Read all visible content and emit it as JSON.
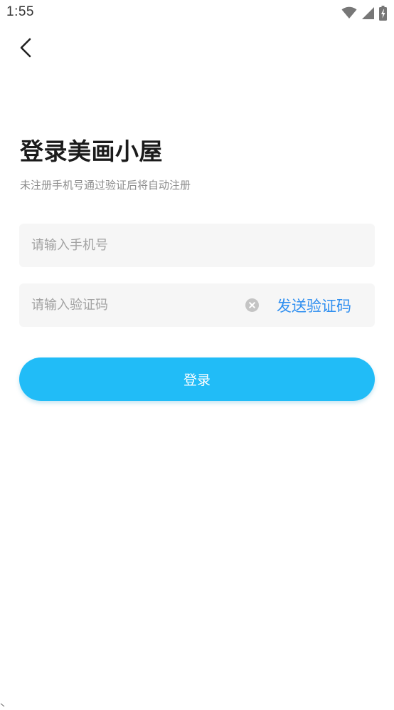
{
  "status_bar": {
    "time": "1:55",
    "icons": [
      "wifi-icon",
      "signal-icon",
      "battery-charging-icon"
    ]
  },
  "header": {
    "back_icon": "chevron-left-icon"
  },
  "login": {
    "title": "登录美画小屋",
    "subtitle": "未注册手机号通过验证后将自动注册",
    "phone_placeholder": "请输入手机号",
    "code_placeholder": "请输入验证码",
    "clear_icon": "clear-circle-icon",
    "send_code_label": "发送验证码",
    "submit_label": "登录"
  },
  "colors": {
    "accent": "#21bcf7",
    "link": "#2f8ff0",
    "field_bg": "#f6f6f6",
    "placeholder": "#a3a3a3",
    "subtitle": "#8c8c8c"
  }
}
